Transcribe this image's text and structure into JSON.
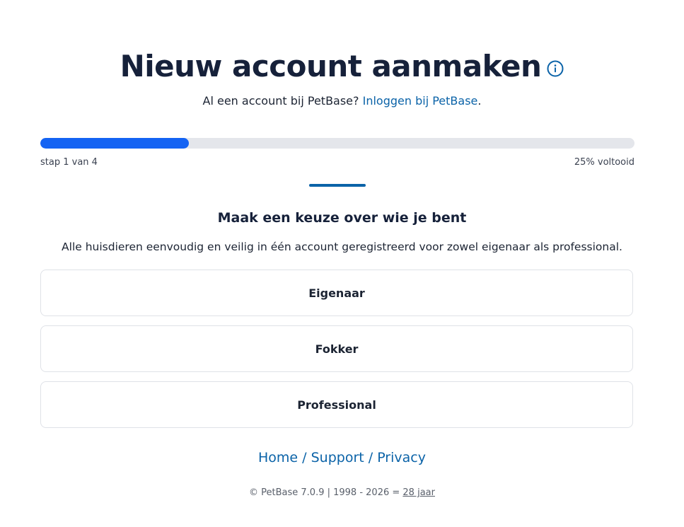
{
  "header": {
    "title": "Nieuw account aanmaken",
    "subtitle_prefix": "Al een account bij PetBase?",
    "login_link": "Inloggen bij PetBase",
    "subtitle_suffix": "."
  },
  "progress": {
    "step_text": "stap 1 van 4",
    "percent_text": "25% voltooid",
    "fraction": 0.25,
    "fill_color": "#1463f3"
  },
  "section": {
    "heading": "Maak een keuze over wie je bent",
    "description": "Alle huisdieren eenvoudig en veilig in één account geregistreerd voor zowel eigenaar als professional."
  },
  "choices": [
    {
      "label": "Eigenaar"
    },
    {
      "label": "Fokker"
    },
    {
      "label": "Professional"
    }
  ],
  "footer": {
    "links": [
      {
        "label": "Home"
      },
      {
        "label": "Support"
      },
      {
        "label": "Privacy"
      }
    ],
    "separator": " / ",
    "copyright_prefix": "© PetBase 7.0.9 | 1998 - 2026 =",
    "years_text": "28 jaar"
  },
  "colors": {
    "accent": "#0b63a8",
    "progress": "#1463f3"
  },
  "icons": {
    "title_icon": "info-icon"
  }
}
